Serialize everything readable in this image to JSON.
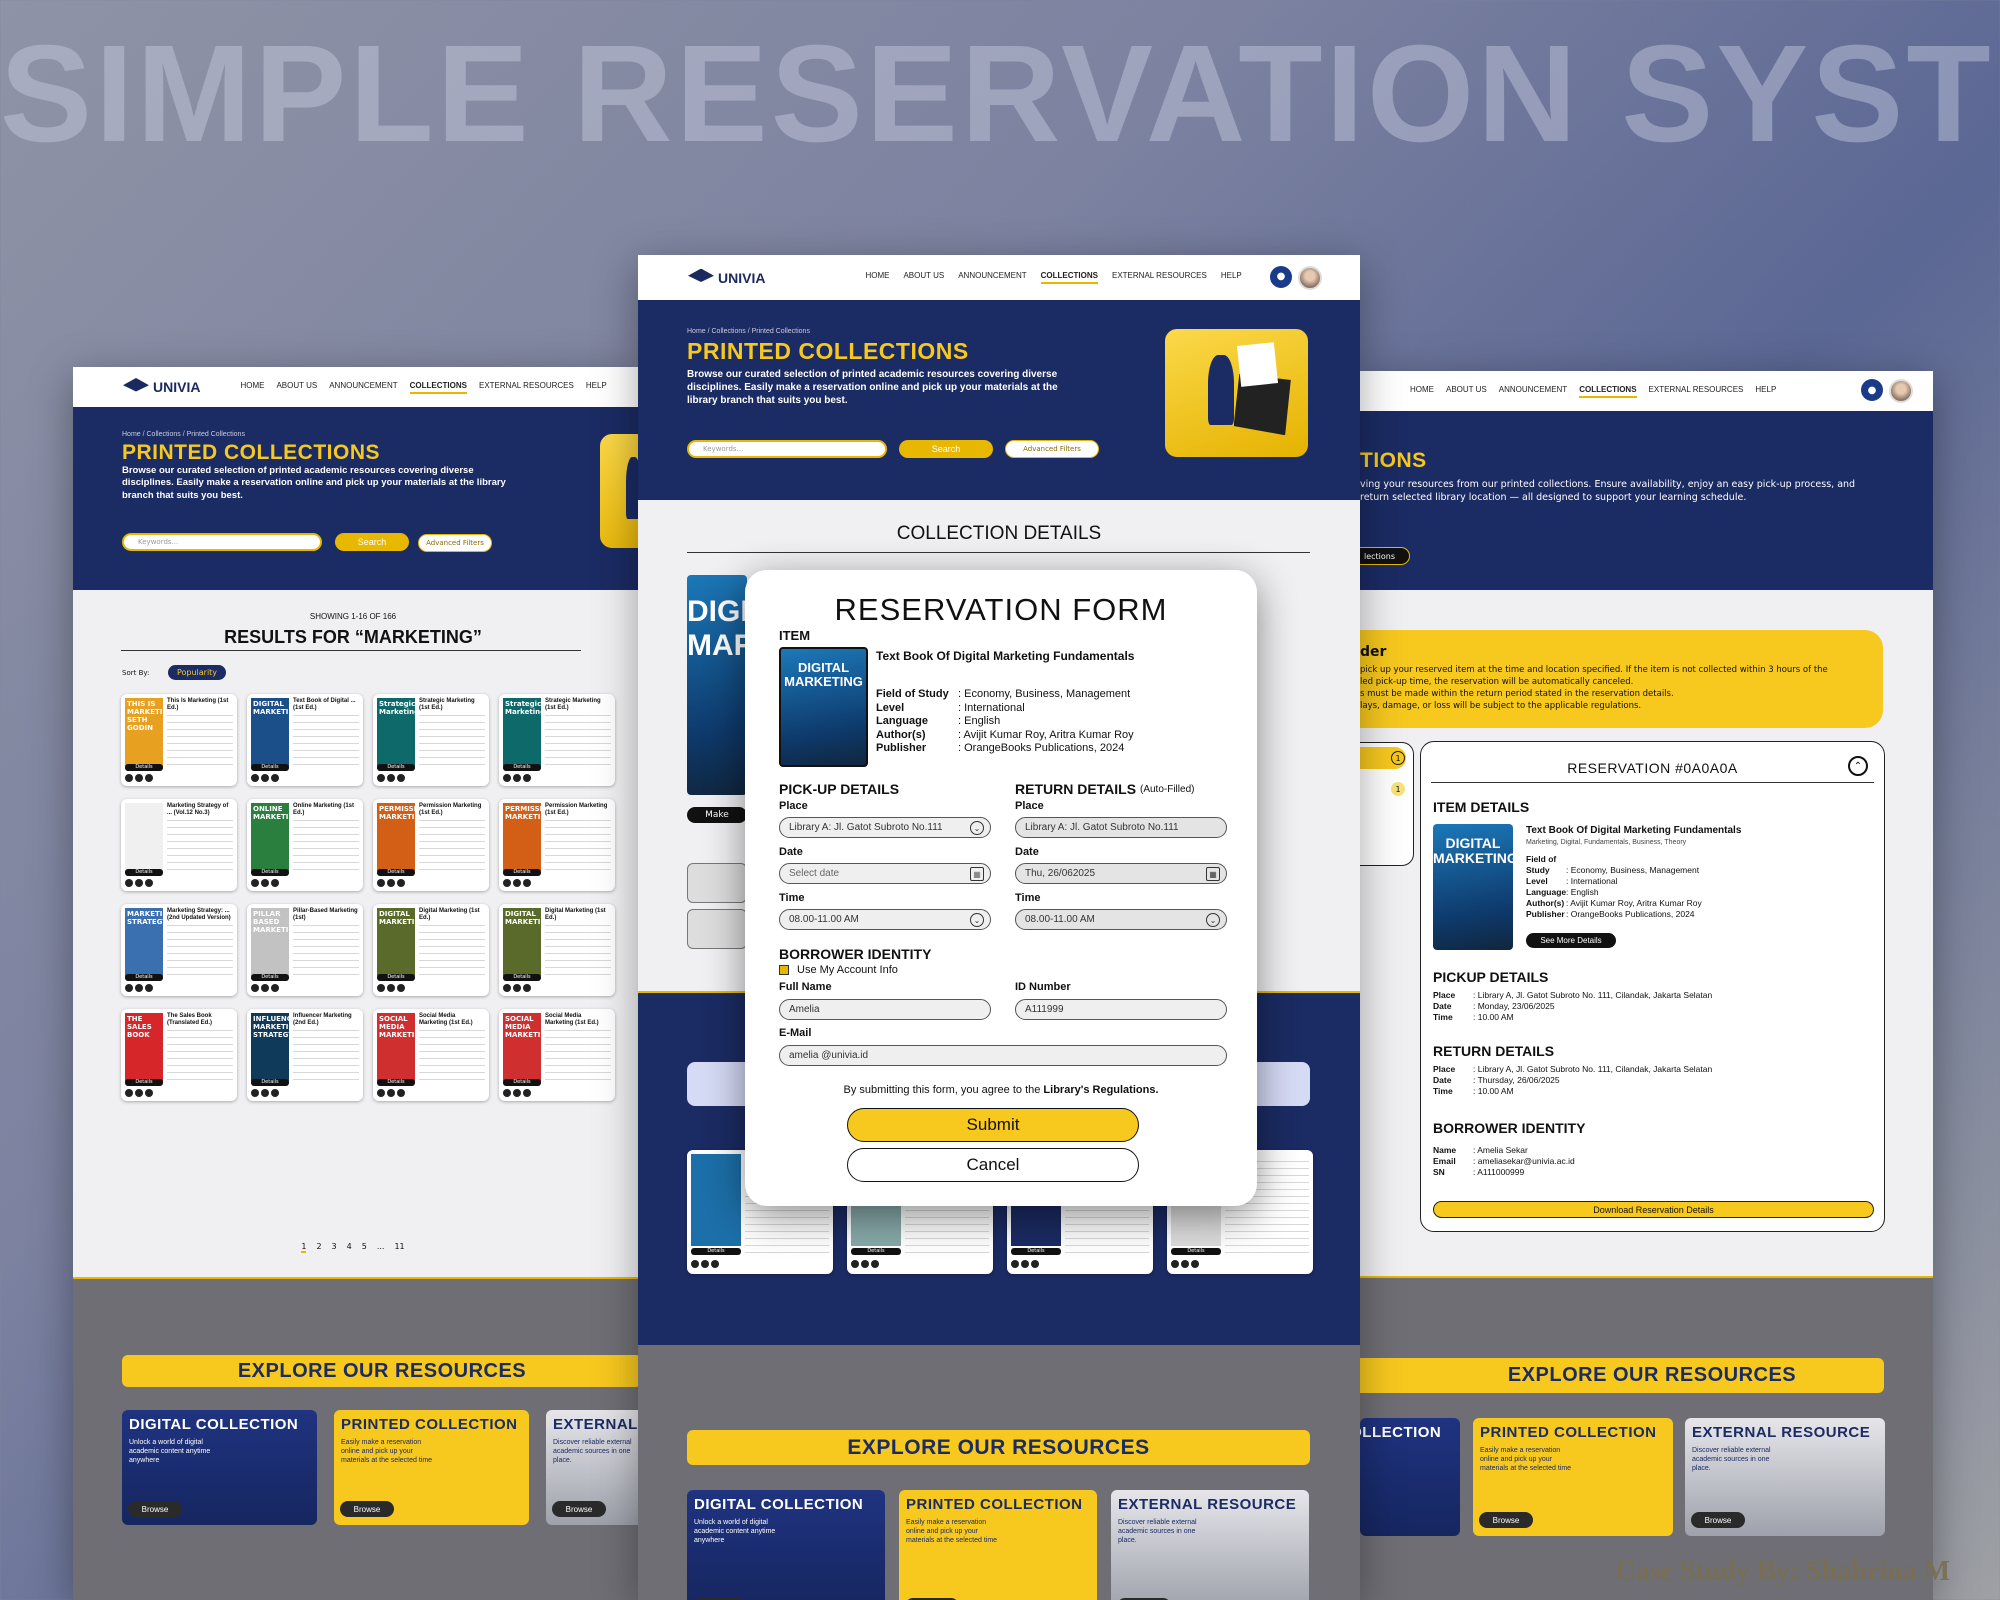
{
  "hero_title": "SIMPLE RESERVATION SYSTEM",
  "credit": "Case Study By: Shabrina M",
  "colors": {
    "navy": "#1b2b63",
    "accent": "#f7c81e"
  },
  "nav": {
    "brand": "UNIVIA",
    "links": [
      "HOME",
      "ABOUT US",
      "ANNOUNCEMENT",
      "COLLECTIONS",
      "EXTERNAL RESOURCES",
      "HELP"
    ],
    "active": "COLLECTIONS",
    "icons": [
      "bell-icon",
      "avatar"
    ]
  },
  "banner": {
    "breadcrumb": "Home / Collections / Printed Collections",
    "title": "PRINTED COLLECTIONS",
    "description": "Browse our curated selection of printed academic resources covering diverse disciplines. Easily make a reservation online and pick up your materials at the library branch that suits you best.",
    "search_placeholder": "Keywords...",
    "search_button": "Search",
    "filters_button": "Advanced Filters"
  },
  "results": {
    "showing": "SHOWING 1-16 OF 166",
    "heading": "RESULTS FOR “MARKETING”",
    "sort_label": "Sort By:",
    "sort_value": "Popularity",
    "detail_label": "Details",
    "books": [
      {
        "title": "This Is Marketing (1st Ed.)",
        "cover": "THIS IS MARKETING SETH GODIN"
      },
      {
        "title": "Text Book of Digital ... (1st Ed.)",
        "cover": "DIGITAL MARKETING"
      },
      {
        "title": "Strategic Marketing (1st Ed.)",
        "cover": "Strategic Marketing"
      },
      {
        "title": "Marketing Strategy of ... (Vol.12 No.3)",
        "cover": ""
      },
      {
        "title": "Online Marketing (1st Ed.)",
        "cover": "ONLINE MARKETING"
      },
      {
        "title": "Permission Marketing (1st Ed.)",
        "cover": "PERMISSION MARKETING"
      },
      {
        "title": "Marketing Strategy: ... (2nd Updated Version)",
        "cover": "MARKETING STRATEGY"
      },
      {
        "title": "Pillar-Based Marketing (1st)",
        "cover": "PILLAR BASED MARKETING"
      },
      {
        "title": "Digital Marketing (1st Ed.)",
        "cover": "DIGITAL MARKETING"
      },
      {
        "title": "The Sales Book (Translated Ed.)",
        "cover": "THE SALES BOOK"
      },
      {
        "title": "Influencer Marketing (2nd Ed.)",
        "cover": "INFLUENCER MARKETING STRATEGY"
      },
      {
        "title": "Social Media Marketing (1st Ed.)",
        "cover": "SOCIAL MEDIA MARKETING"
      }
    ],
    "pages": [
      "1",
      "2",
      "3",
      "4",
      "5",
      "...",
      "11"
    ]
  },
  "explore": {
    "heading": "EXPLORE OUR RESOURCES",
    "cards": [
      {
        "title": "DIGITAL COLLECTION",
        "desc": "Unlock a world of digital academic content anytime anywhere",
        "button": "Browse"
      },
      {
        "title": "PRINTED COLLECTION",
        "desc": "Easily make a reservation online and pick up your materials at the selected time",
        "button": "Browse"
      },
      {
        "title": "EXTERNAL  RESOURCE",
        "desc": "Discover reliable external academic sources in one place.",
        "button": "Browse"
      }
    ]
  },
  "collection_details": {
    "heading": "COLLECTION DETAILS",
    "make_btn": "Make"
  },
  "form": {
    "title": "RESERVATION FORM",
    "item_label": "ITEM",
    "book_title": "Text Book Of Digital Marketing Fundamentals",
    "meta": [
      {
        "k": "Field of Study",
        "v": ": Economy, Business, Management"
      },
      {
        "k": "Level",
        "v": ": International"
      },
      {
        "k": "Language",
        "v": ": English"
      },
      {
        "k": "Author(s)",
        "v": ": Avijit Kumar Roy, Aritra Kumar Roy"
      },
      {
        "k": "Publisher",
        "v": ": OrangeBooks Publications, 2024"
      }
    ],
    "pickup_label": "PICK-UP DETAILS",
    "return_label": "RETURN DETAILS",
    "auto_filled": "(Auto-Filled)",
    "place_label": "Place",
    "date_label": "Date",
    "time_label": "Time",
    "pickup_place": "Library A: Jl. Gatot Subroto No.111",
    "pickup_date": "Select date",
    "pickup_time": "08.00-11.00 AM",
    "return_place": "Library A: Jl. Gatot Subroto No.111",
    "return_date": "Thu, 26/062025",
    "return_time": "08.00-11.00 AM",
    "borrower_label": "BORROWER IDENTITY",
    "use_account": "Use My Account Info",
    "fullname_label": "Full Name",
    "fullname": "Amelia",
    "id_label": "ID Number",
    "id_value": "A111999",
    "email_label": "E-Mail",
    "email": "amelia @univia.id",
    "agree_prefix": "By submitting this form, you agree to the ",
    "agree_link": "Library's Regulations.",
    "submit": "Submit",
    "cancel": "Cancel"
  },
  "right_panel": {
    "title_partial": "TIONS",
    "desc_partial": "ving your resources from our printed collections. Ensure availability, enjoy an easy pick-up process, and return selected library location — all designed to support your learning schedule.",
    "btn_partial": "lections",
    "reminder_title": "der",
    "reminder_lines": [
      "pick up your reserved item at the time and location specified. If the item is not collected within 3 hours of the",
      "led pick-up time, the reservation will be automatically canceled.",
      "s must be made within the return period stated in the reservation details.",
      "lays, damage, or loss will be subject to the applicable regulations."
    ],
    "tab_counts": [
      "1",
      "1"
    ]
  },
  "reservation": {
    "heading": "RESERVATION #0A0A0A",
    "item_details": "ITEM DETAILS",
    "book_title": "Text Book Of Digital Marketing Fundamentals",
    "tags": "Marketing, Digital, Fundamentals, Business, Theory",
    "meta": [
      {
        "k": "Field of Study",
        "v": ": Economy, Business, Management"
      },
      {
        "k": "Level",
        "v": ": International"
      },
      {
        "k": "Language",
        "v": ": English"
      },
      {
        "k": "Author(s)",
        "v": ": Avijit Kumar Roy, Aritra Kumar Roy"
      },
      {
        "k": "Publisher",
        "v": ": OrangeBooks Publications, 2024"
      }
    ],
    "see_more": "See More Details",
    "pickup_heading": "PICKUP  DETAILS",
    "pickup": [
      {
        "k": "Place",
        "v": ": Library A, Jl. Gatot Subroto No. 111, Cilandak, Jakarta Selatan"
      },
      {
        "k": "Date",
        "v": ": Monday, 23/06/2025"
      },
      {
        "k": "Time",
        "v": ": 10.00 AM"
      }
    ],
    "return_heading": "RETURN  DETAILS",
    "return": [
      {
        "k": "Place",
        "v": ": Library A, Jl. Gatot Subroto No. 111, Cilandak, Jakarta Selatan"
      },
      {
        "k": "Date",
        "v": ": Thursday, 26/06/2025"
      },
      {
        "k": "Time",
        "v": ": 10.00 AM"
      }
    ],
    "borrower_heading": "BORROWER IDENTITY",
    "borrower": [
      {
        "k": "Name",
        "v": ": Amelia Sekar"
      },
      {
        "k": "Email",
        "v": ": ameliasekar@univia.ac.id"
      },
      {
        "k": "SN",
        "v": ": A111000999"
      }
    ],
    "download": "Download Reservation Details"
  }
}
